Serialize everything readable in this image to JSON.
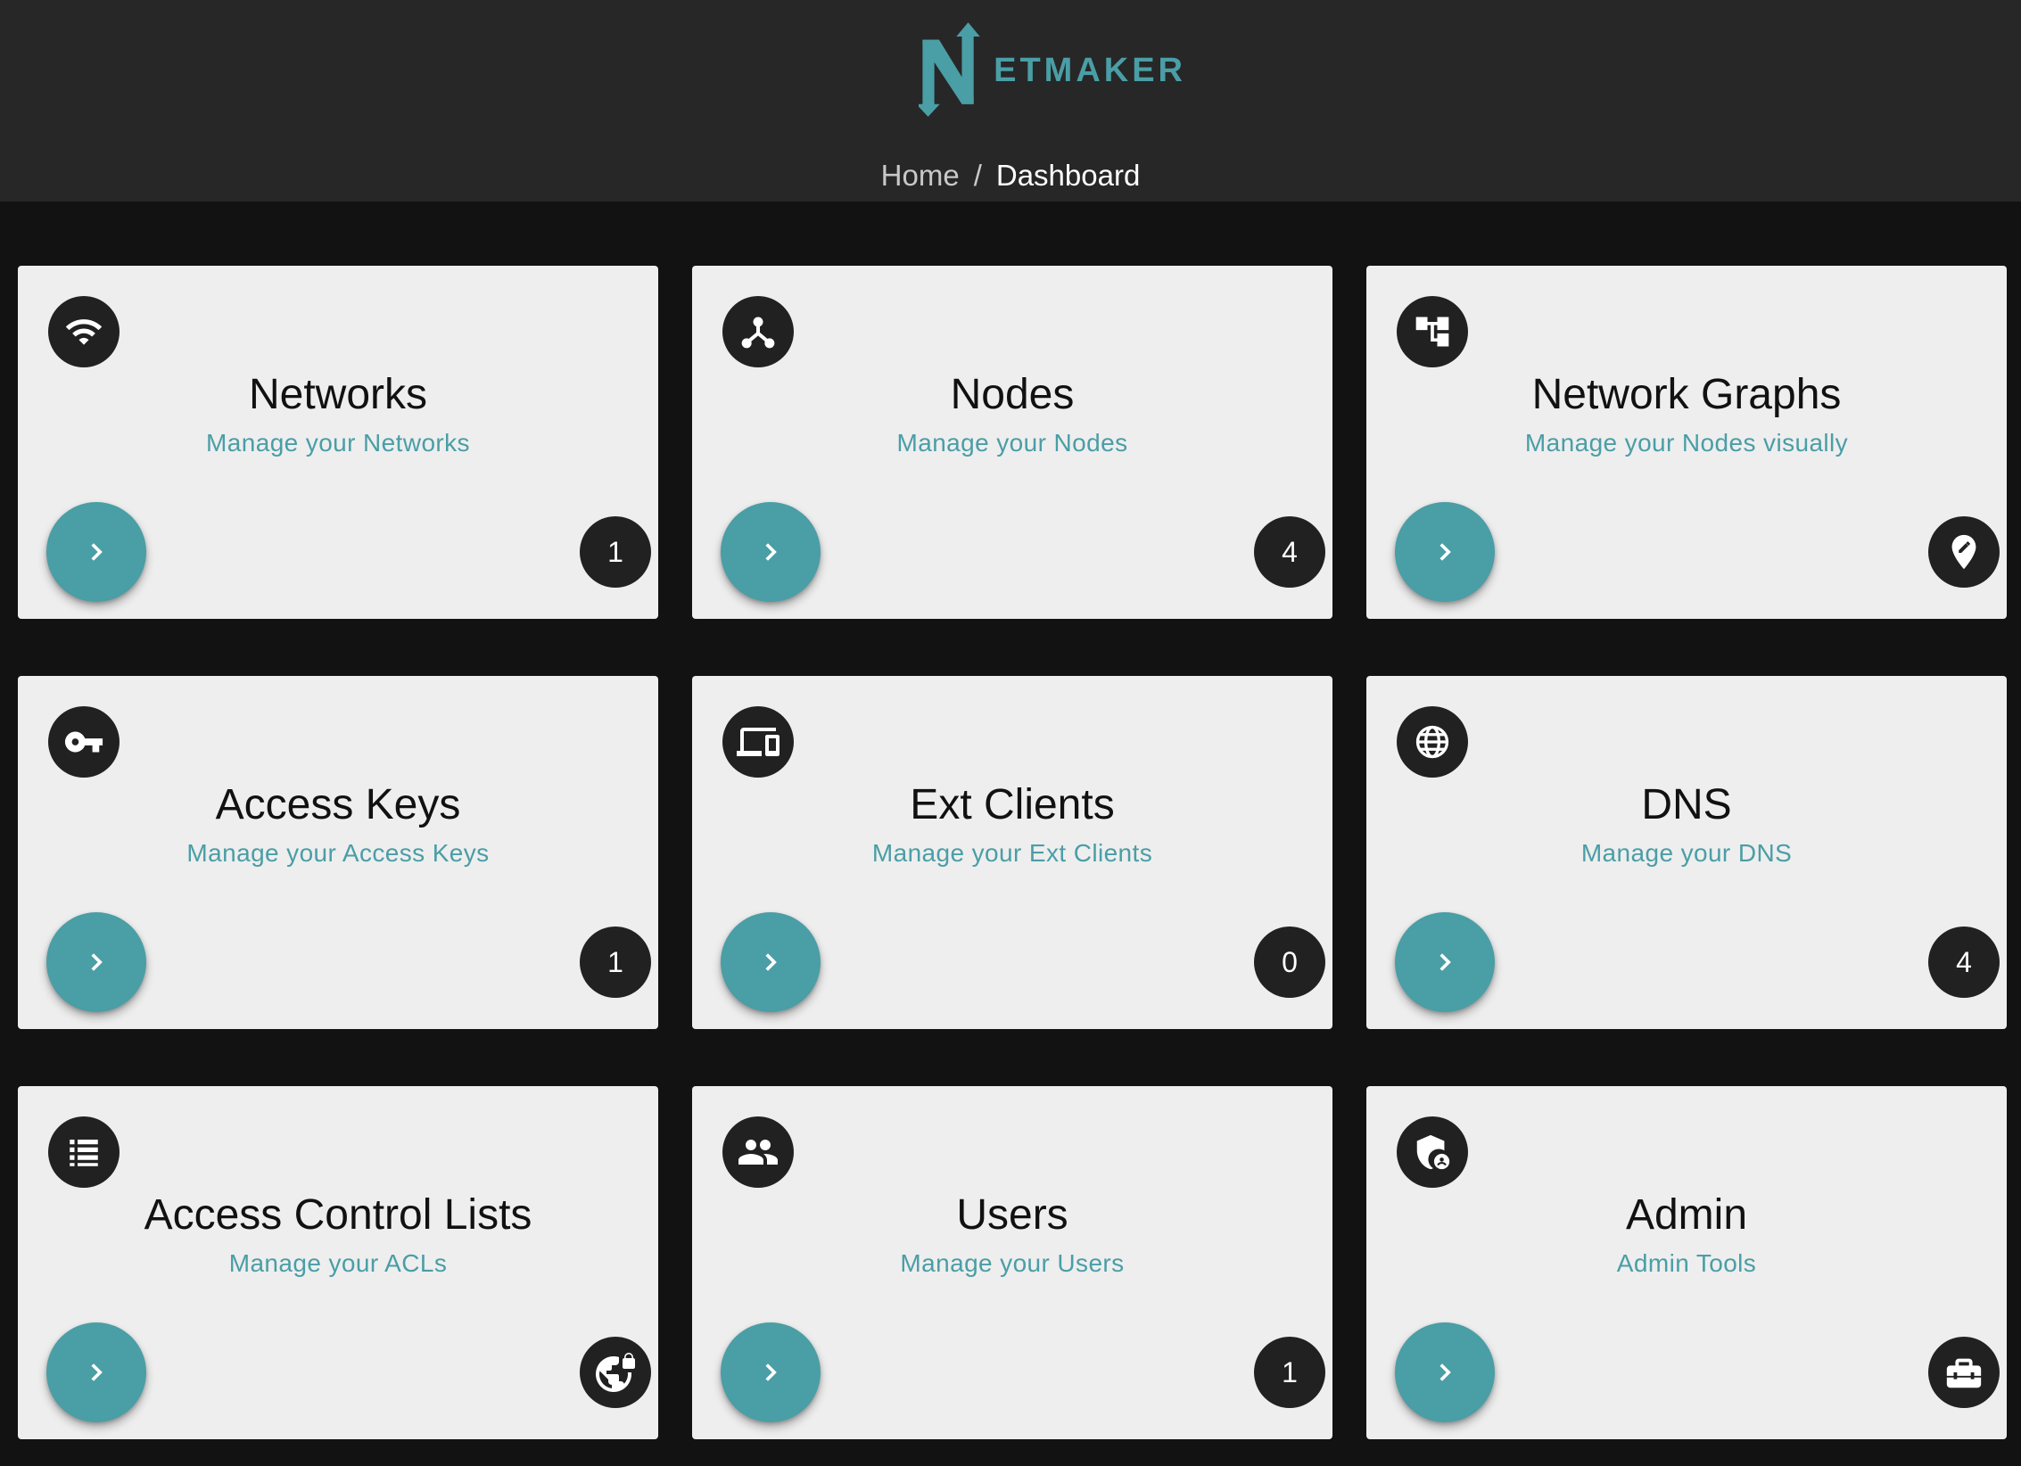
{
  "app": {
    "logo_text": "ETMAKER",
    "accent_color": "#4a9ea6"
  },
  "breadcrumb": {
    "home": "Home",
    "separator": "/",
    "current": "Dashboard"
  },
  "cards": [
    {
      "title": "Networks",
      "subtitle": "Manage your Networks",
      "icon": "wifi-icon",
      "count": "1"
    },
    {
      "title": "Nodes",
      "subtitle": "Manage your Nodes",
      "icon": "nodes-icon",
      "count": "4"
    },
    {
      "title": "Network Graphs",
      "subtitle": "Manage your Nodes visually",
      "icon": "account-tree-icon",
      "badge_icon": "edit-location-icon"
    },
    {
      "title": "Access Keys",
      "subtitle": "Manage your Access Keys",
      "icon": "key-icon",
      "count": "1"
    },
    {
      "title": "Ext Clients",
      "subtitle": "Manage your Ext Clients",
      "icon": "devices-icon",
      "count": "0"
    },
    {
      "title": "DNS",
      "subtitle": "Manage your DNS",
      "icon": "globe-icon",
      "count": "4"
    },
    {
      "title": "Access Control Lists",
      "subtitle": "Manage your ACLs",
      "icon": "list-icon",
      "badge_icon": "vpn-lock-icon"
    },
    {
      "title": "Users",
      "subtitle": "Manage your Users",
      "icon": "group-icon",
      "count": "1"
    },
    {
      "title": "Admin",
      "subtitle": "Admin Tools",
      "icon": "admin-shield-icon",
      "badge_icon": "toolbox-icon"
    }
  ]
}
